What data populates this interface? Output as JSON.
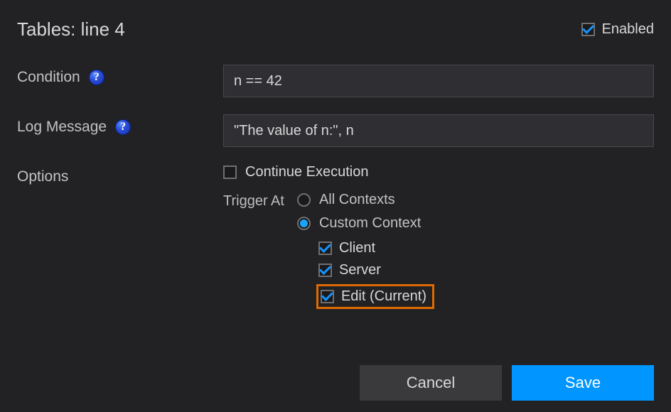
{
  "header": {
    "title": "Tables: line 4",
    "enabled_label": "Enabled",
    "enabled_checked": true
  },
  "fields": {
    "condition": {
      "label": "Condition",
      "value": "n == 42",
      "help": "?"
    },
    "log_message": {
      "label": "Log Message",
      "value": "\"The value of n:\", n",
      "help": "?"
    }
  },
  "options": {
    "label": "Options",
    "continue_execution": {
      "label": "Continue Execution",
      "checked": false
    },
    "trigger_at": {
      "label": "Trigger At",
      "radios": {
        "all_contexts": {
          "label": "All Contexts",
          "selected": false
        },
        "custom_context": {
          "label": "Custom Context",
          "selected": true
        }
      },
      "sub_checks": {
        "client": {
          "label": "Client",
          "checked": true
        },
        "server": {
          "label": "Server",
          "checked": true
        },
        "edit_current": {
          "label": "Edit (Current)",
          "checked": true
        }
      }
    }
  },
  "buttons": {
    "cancel": "Cancel",
    "save": "Save"
  }
}
